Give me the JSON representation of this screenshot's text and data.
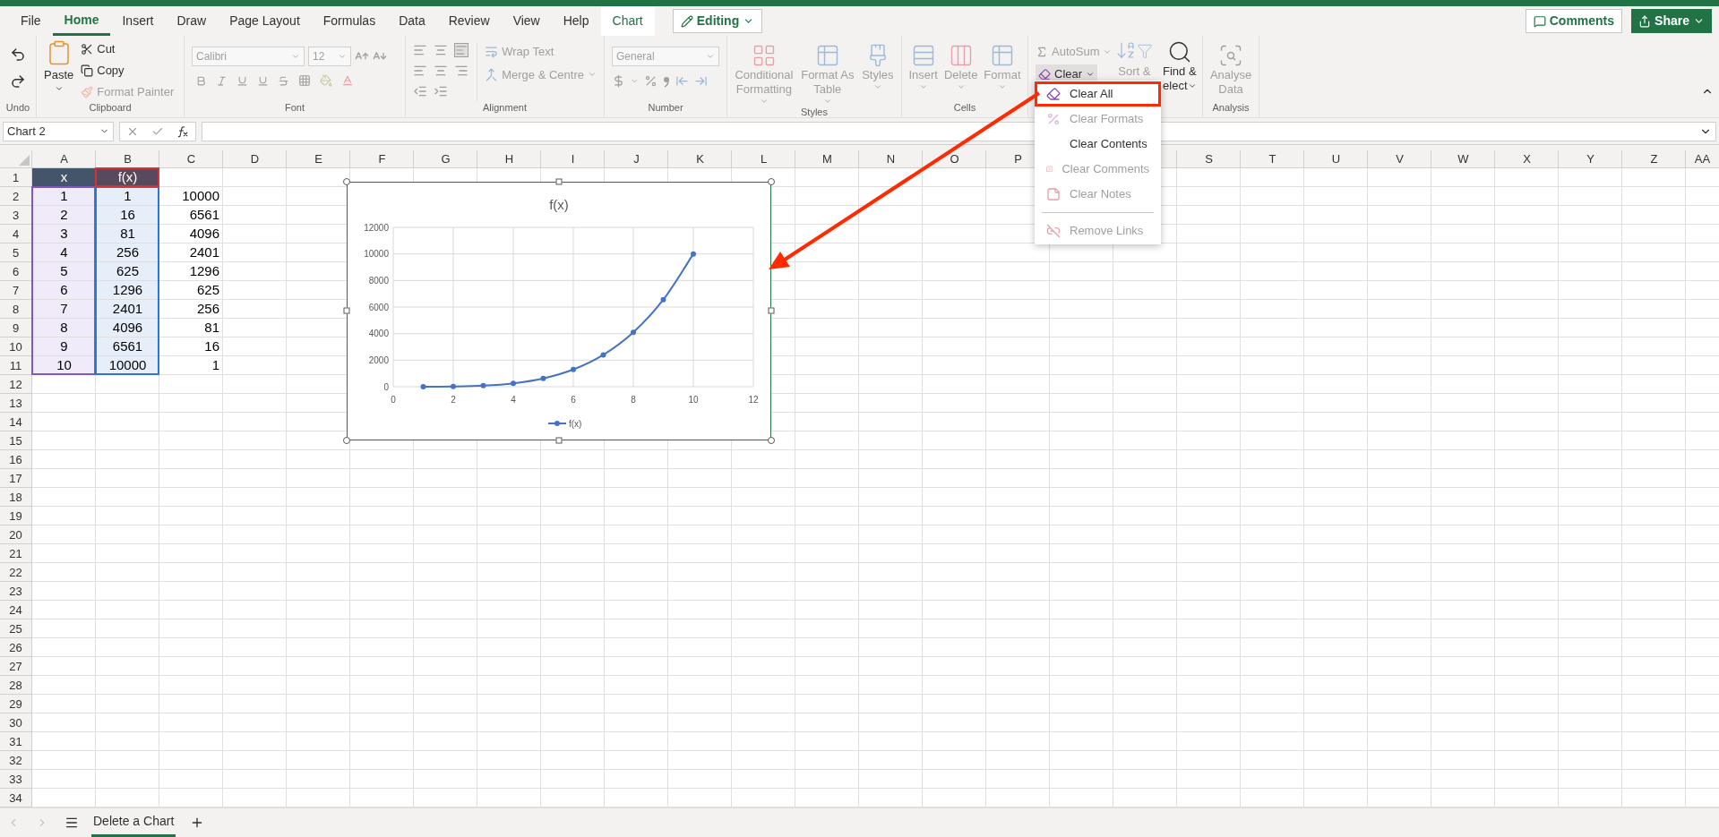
{
  "menu_tabs": [
    {
      "label": "File",
      "selected": false,
      "kind": "normal"
    },
    {
      "label": "Home",
      "selected": true,
      "kind": "normal"
    },
    {
      "label": "Insert",
      "selected": false,
      "kind": "normal"
    },
    {
      "label": "Draw",
      "selected": false,
      "kind": "normal"
    },
    {
      "label": "Page Layout",
      "selected": false,
      "kind": "normal"
    },
    {
      "label": "Formulas",
      "selected": false,
      "kind": "normal"
    },
    {
      "label": "Data",
      "selected": false,
      "kind": "normal"
    },
    {
      "label": "Review",
      "selected": false,
      "kind": "normal"
    },
    {
      "label": "View",
      "selected": false,
      "kind": "normal"
    },
    {
      "label": "Help",
      "selected": false,
      "kind": "normal"
    },
    {
      "label": "Chart",
      "selected": false,
      "kind": "contextual"
    }
  ],
  "mode_button": {
    "label": "Editing"
  },
  "comments_button": {
    "label": "Comments"
  },
  "share_button": {
    "label": "Share"
  },
  "ribbon": {
    "undo": {
      "label": "Undo"
    },
    "clipboard": {
      "label": "Clipboard",
      "paste": {
        "label": "Paste",
        "disabled": false
      },
      "cut": {
        "label": "Cut",
        "disabled": false
      },
      "copy": {
        "label": "Copy",
        "disabled": false
      },
      "format_painter": {
        "label": "Format Painter",
        "disabled": true
      }
    },
    "font": {
      "label": "Font",
      "font_name": {
        "value": "Calibri",
        "disabled": true
      },
      "font_size": {
        "value": "12",
        "disabled": true
      }
    },
    "alignment": {
      "label": "Alignment",
      "wrap_text": {
        "label": "Wrap Text",
        "disabled": true
      },
      "merge": {
        "label": "Merge & Centre",
        "disabled": true
      }
    },
    "number": {
      "label": "Number",
      "format": {
        "value": "General",
        "disabled": true
      }
    },
    "styles": {
      "label": "Styles",
      "buttons": [
        {
          "lines": [
            "Conditional",
            "Formatting"
          ],
          "disabled": true
        },
        {
          "lines": [
            "Format As",
            "Table"
          ],
          "disabled": true
        },
        {
          "lines": [
            "Styles"
          ],
          "disabled": true
        }
      ]
    },
    "cells": {
      "label": "Cells",
      "buttons": [
        {
          "lines": [
            "Insert"
          ],
          "disabled": true
        },
        {
          "lines": [
            "Delete"
          ],
          "disabled": true
        },
        {
          "lines": [
            "Format"
          ],
          "disabled": true
        }
      ]
    },
    "editing": {
      "autosum": {
        "label": "AutoSum",
        "disabled": true
      },
      "clear": {
        "label": "Clear",
        "open": true
      },
      "sort": {
        "lines": [
          "Sort &"
        ],
        "disabled": true
      },
      "find": {
        "lines": [
          "Find &",
          "elect"
        ],
        "disabled": false
      }
    },
    "analysis": {
      "label": "Analysis",
      "buttons": [
        {
          "lines": [
            "Analyse",
            "Data"
          ],
          "disabled": true
        }
      ]
    }
  },
  "formula_bar": {
    "name_box": "Chart 2"
  },
  "sheet": {
    "columns": [
      {
        "label": "A",
        "color": "#7e57c2"
      },
      {
        "label": "B",
        "color": "#2e75d6"
      },
      {
        "label": "C"
      },
      {
        "label": "D"
      },
      {
        "label": "E"
      },
      {
        "label": "F"
      },
      {
        "label": "G"
      },
      {
        "label": "H"
      },
      {
        "label": "I"
      },
      {
        "label": "J"
      },
      {
        "label": "K"
      },
      {
        "label": "L"
      },
      {
        "label": "M"
      },
      {
        "label": "N"
      },
      {
        "label": "O"
      },
      {
        "label": "P"
      },
      {},
      {},
      {
        "label": "S"
      },
      {
        "label": "T"
      },
      {
        "label": "U"
      },
      {
        "label": "V"
      },
      {
        "label": "W"
      },
      {
        "label": "X"
      },
      {
        "label": "Y"
      },
      {
        "label": "Z"
      },
      {
        "label": "AA"
      }
    ],
    "rows": [
      {
        "label": "1",
        "kind": "header",
        "cells": [
          {
            "text": "x"
          },
          {
            "text": "f(x)",
            "color": "#d13438"
          }
        ]
      },
      {
        "label": "2",
        "kind": "data",
        "cells": [
          "1",
          "1",
          "10000"
        ]
      },
      {
        "label": "3",
        "kind": "data",
        "cells": [
          "2",
          "16",
          "6561"
        ]
      },
      {
        "label": "4",
        "kind": "data",
        "cells": [
          "3",
          "81",
          "4096"
        ]
      },
      {
        "label": "5",
        "kind": "data",
        "cells": [
          "4",
          "256",
          "2401"
        ]
      },
      {
        "label": "6",
        "kind": "data",
        "cells": [
          "5",
          "625",
          "1296"
        ]
      },
      {
        "label": "7",
        "kind": "data",
        "cells": [
          "6",
          "1296",
          "625"
        ]
      },
      {
        "label": "8",
        "kind": "data",
        "cells": [
          "7",
          "2401",
          "256"
        ]
      },
      {
        "label": "9",
        "kind": "data",
        "cells": [
          "8",
          "4096",
          "81"
        ]
      },
      {
        "label": "10",
        "kind": "data",
        "cells": [
          "9",
          "6561",
          "16"
        ]
      },
      {
        "label": "11",
        "kind": "data",
        "cells": [
          "10",
          "10000",
          "1"
        ]
      },
      {
        "label": "12"
      },
      {
        "label": "13"
      },
      {
        "label": "14"
      },
      {
        "label": "15"
      },
      {
        "label": "16"
      },
      {
        "label": "17"
      },
      {
        "label": "18"
      },
      {
        "label": "19"
      },
      {
        "label": "20"
      },
      {
        "label": "21"
      },
      {
        "label": "22"
      },
      {
        "label": "23"
      },
      {
        "label": "24"
      },
      {
        "label": "25"
      },
      {
        "label": "26"
      },
      {
        "label": "27"
      },
      {
        "label": "28"
      },
      {
        "label": "29"
      },
      {
        "label": "30"
      },
      {
        "label": "31"
      },
      {
        "label": "32"
      },
      {
        "label": "33"
      },
      {
        "label": "34"
      }
    ]
  },
  "chart": {
    "selected": true,
    "chart_data": {
      "type": "line",
      "title": "f(x)",
      "grid": true,
      "x": [
        1,
        2,
        3,
        4,
        5,
        6,
        7,
        8,
        9,
        10
      ],
      "series": [
        {
          "name": "f(x)",
          "color": "#4472c4",
          "marker": "circle",
          "values": [
            1,
            16,
            81,
            256,
            625,
            1296,
            2401,
            4096,
            6561,
            10000
          ]
        }
      ],
      "xlim": [
        0,
        12
      ],
      "ylim": [
        0,
        12000
      ],
      "xticks": [
        0,
        2,
        4,
        6,
        8,
        10,
        12
      ],
      "yticks": [
        0,
        2000,
        4000,
        6000,
        8000,
        10000,
        12000
      ]
    }
  },
  "clear_menu": {
    "items": [
      {
        "label": "Clear All",
        "kind": "eraser",
        "disabled": false,
        "annotated": true,
        "separator_before": false
      },
      {
        "label": "Clear Formats",
        "kind": "formats",
        "disabled": true,
        "annotated": false,
        "separator_before": false
      },
      {
        "label": "Clear Contents",
        "kind": "plain",
        "disabled": false,
        "annotated": false,
        "separator_before": false
      },
      {
        "label": "Clear Comments",
        "kind": "comment",
        "disabled": true,
        "annotated": false,
        "separator_before": false
      },
      {
        "label": "Clear Notes",
        "kind": "note",
        "disabled": true,
        "annotated": false,
        "separator_before": false
      },
      {
        "label": "Remove Links",
        "kind": "link",
        "disabled": true,
        "annotated": false,
        "separator_before": true
      }
    ]
  },
  "sheet_tabs": [
    {
      "label": "Delete a Chart",
      "selected": true
    }
  ]
}
